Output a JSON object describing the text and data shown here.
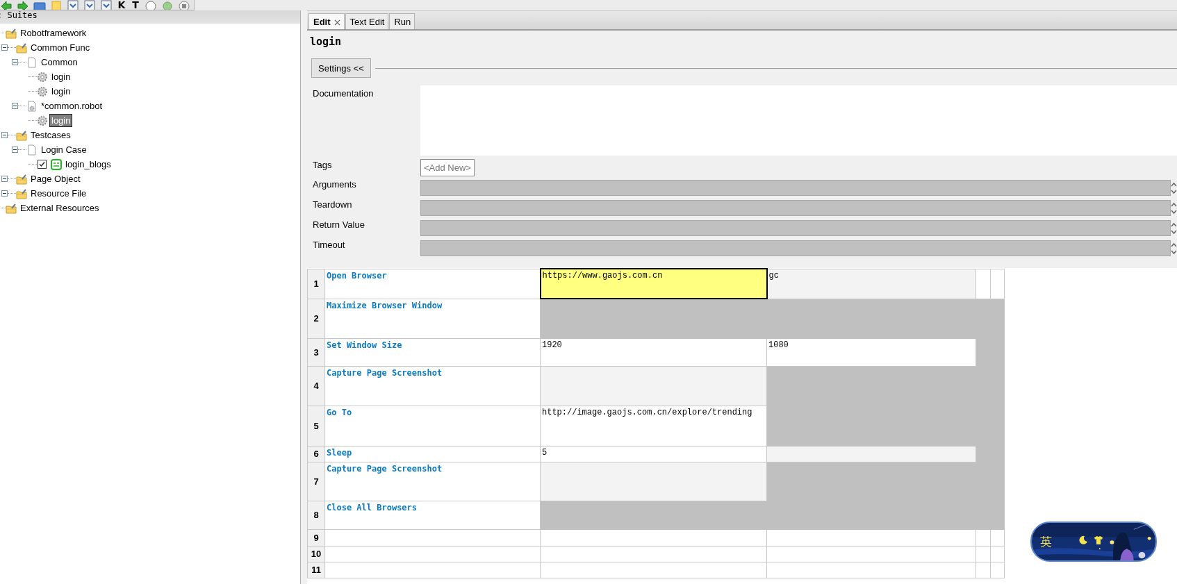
{
  "toolbar": {
    "text_buttons": [
      "K",
      "T"
    ]
  },
  "tree": {
    "header": ": Suites",
    "nodes": [
      {
        "label": "Robotframework",
        "kind": "project",
        "selected": false,
        "children": [
          {
            "label": "Common Func",
            "kind": "project",
            "expanded": true,
            "selected": false,
            "children": [
              {
                "label": "Common",
                "kind": "file",
                "expanded": true,
                "selected": false,
                "children": [
                  {
                    "label": "login",
                    "kind": "keyword",
                    "selected": false
                  },
                  {
                    "label": "login",
                    "kind": "keyword",
                    "selected": false
                  }
                ]
              },
              {
                "label": "*common.robot",
                "kind": "resource",
                "expanded": true,
                "selected": false,
                "children": [
                  {
                    "label": "login",
                    "kind": "keyword",
                    "selected": true
                  }
                ]
              }
            ]
          },
          {
            "label": "Testcases",
            "kind": "project",
            "expanded": true,
            "selected": false,
            "children": [
              {
                "label": "Login Case",
                "kind": "file",
                "expanded": true,
                "selected": false,
                "children": [
                  {
                    "label": "login_blogs",
                    "kind": "test",
                    "checked": true,
                    "selected": false
                  }
                ]
              }
            ]
          },
          {
            "label": "Page Object",
            "kind": "project",
            "expanded": true,
            "selected": false
          },
          {
            "label": "Resource File",
            "kind": "project",
            "expanded": true,
            "selected": false
          }
        ]
      },
      {
        "label": "External Resources",
        "kind": "project",
        "selected": false
      }
    ]
  },
  "tabs": [
    {
      "label": "Edit",
      "selected": true,
      "closable": true
    },
    {
      "label": "Text Edit",
      "selected": false,
      "closable": false
    },
    {
      "label": "Run",
      "selected": false,
      "closable": false
    }
  ],
  "editor": {
    "title": "login",
    "settings_button": "Settings <<",
    "documentation_label": "Documentation",
    "tags_label": "Tags",
    "tags_add": "<Add New>",
    "fields": [
      {
        "label": "Arguments"
      },
      {
        "label": "Teardown"
      },
      {
        "label": "Return Value"
      },
      {
        "label": "Timeout"
      }
    ]
  },
  "grid": {
    "rows": [
      {
        "number": "1",
        "keyword": "Open Browser",
        "cells": [
          {
            "text": "https://www.gaojs.com.cn",
            "kind": "arg",
            "selected": true
          },
          {
            "text": "gc",
            "kind": "optional",
            "selected": false
          },
          {
            "kind": "empty",
            "selected": false
          },
          {
            "kind": "empty",
            "selected": false
          }
        ]
      },
      {
        "number": "2",
        "keyword": "Maximize Browser Window",
        "cells": [
          {
            "kind": "unused",
            "selected": false
          },
          {
            "kind": "unused",
            "selected": false
          },
          {
            "kind": "unused",
            "selected": false
          },
          {
            "kind": "unused",
            "selected": false
          }
        ]
      },
      {
        "number": "3",
        "keyword": "Set Window Size",
        "cells": [
          {
            "text": "1920",
            "kind": "arg",
            "selected": false
          },
          {
            "text": "1080",
            "kind": "arg",
            "selected": false
          },
          {
            "kind": "unused",
            "selected": false
          },
          {
            "kind": "unused",
            "selected": false
          }
        ]
      },
      {
        "number": "4",
        "keyword": "Capture Page Screenshot",
        "cells": [
          {
            "kind": "optional",
            "selected": false
          },
          {
            "kind": "unused",
            "selected": false
          },
          {
            "kind": "unused",
            "selected": false
          },
          {
            "kind": "unused",
            "selected": false
          }
        ]
      },
      {
        "number": "5",
        "keyword": "Go To",
        "cells": [
          {
            "text": "http://image.gaojs.com.cn/explore/trending",
            "kind": "arg",
            "selected": false
          },
          {
            "kind": "unused",
            "selected": false
          },
          {
            "kind": "unused",
            "selected": false
          },
          {
            "kind": "unused",
            "selected": false
          }
        ]
      },
      {
        "number": "6",
        "keyword": "Sleep",
        "cells": [
          {
            "text": "5",
            "kind": "arg",
            "selected": false
          },
          {
            "kind": "optional",
            "selected": false
          },
          {
            "kind": "unused",
            "selected": false
          },
          {
            "kind": "unused",
            "selected": false
          }
        ]
      },
      {
        "number": "7",
        "keyword": "Capture Page Screenshot",
        "cells": [
          {
            "kind": "optional",
            "selected": false
          },
          {
            "kind": "unused",
            "selected": false
          },
          {
            "kind": "unused",
            "selected": false
          },
          {
            "kind": "unused",
            "selected": false
          }
        ]
      },
      {
        "number": "8",
        "keyword": "Close All Browsers",
        "cells": [
          {
            "kind": "unused",
            "selected": false
          },
          {
            "kind": "unused",
            "selected": false
          },
          {
            "kind": "unused",
            "selected": false
          },
          {
            "kind": "unused",
            "selected": false
          }
        ]
      },
      {
        "number": "9",
        "cells": [
          {
            "kind": "empty",
            "selected": false
          },
          {
            "kind": "empty",
            "selected": false
          },
          {
            "kind": "empty",
            "selected": false
          },
          {
            "kind": "empty",
            "selected": false
          }
        ]
      },
      {
        "number": "10",
        "cells": [
          {
            "kind": "empty",
            "selected": false
          },
          {
            "kind": "empty",
            "selected": false
          },
          {
            "kind": "empty",
            "selected": false
          },
          {
            "kind": "empty",
            "selected": false
          }
        ]
      },
      {
        "number": "11",
        "cells": [
          {
            "kind": "empty",
            "selected": false
          },
          {
            "kind": "empty",
            "selected": false
          },
          {
            "kind": "empty",
            "selected": false
          },
          {
            "kind": "empty",
            "selected": false
          }
        ]
      }
    ]
  },
  "ime_toolbar": {
    "mode_label": "英"
  }
}
